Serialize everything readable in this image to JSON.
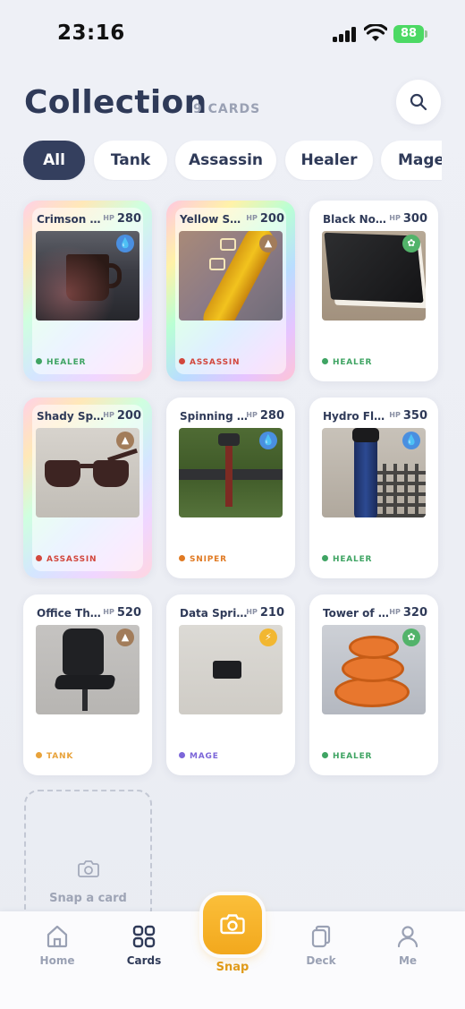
{
  "status_bar": {
    "time": "23:16",
    "battery": "88"
  },
  "header": {
    "title": "Collection",
    "count": "9 CARDS"
  },
  "filters": [
    "All",
    "Tank",
    "Assassin",
    "Healer",
    "Mage"
  ],
  "cards": [
    {
      "name": "Crimson Br...",
      "hp_label": "HP",
      "hp": "280",
      "role": "HEALER",
      "role_color": "#3fa463",
      "element_icon": "water-drop-icon",
      "element_color": "#4a8fe0",
      "photo": "mug"
    },
    {
      "name": "Yellow Spe...",
      "hp_label": "HP",
      "hp": "200",
      "role": "ASSASSIN",
      "role_color": "#d2473d",
      "element_icon": "mountain-icon",
      "element_color": "#a27c5a",
      "photo": "yellow-tube"
    },
    {
      "name": "Black Note...",
      "hp_label": "HP",
      "hp": "300",
      "role": "HEALER",
      "role_color": "#3fa463",
      "element_icon": "leaf-icon",
      "element_color": "#52b36a",
      "photo": "notebook"
    },
    {
      "name": "Shady Spec...",
      "hp_label": "HP",
      "hp": "200",
      "role": "ASSASSIN",
      "role_color": "#d2473d",
      "element_icon": "mountain-icon",
      "element_color": "#a27c5a",
      "photo": "sunglasses"
    },
    {
      "name": "Spinning Sp...",
      "hp_label": "HP",
      "hp": "280",
      "role": "SNIPER",
      "role_color": "#e07a23",
      "element_icon": "water-drop-icon",
      "element_color": "#4a8fe0",
      "photo": "sprinkler"
    },
    {
      "name": "Hydro Flask...",
      "hp_label": "HP",
      "hp": "350",
      "role": "HEALER",
      "role_color": "#3fa463",
      "element_icon": "water-drop-icon",
      "element_color": "#4a8fe0",
      "photo": "flask"
    },
    {
      "name": "Office Thro...",
      "hp_label": "HP",
      "hp": "520",
      "role": "TANK",
      "role_color": "#e8a23a",
      "element_icon": "mountain-icon",
      "element_color": "#a27c5a",
      "photo": "chair"
    },
    {
      "name": "Data Sprite",
      "hp_label": "HP",
      "hp": "210",
      "role": "MAGE",
      "role_color": "#7c66d9",
      "element_icon": "lightning-icon",
      "element_color": "#f2b731",
      "photo": "dongle"
    },
    {
      "name": "Tower of Tr...",
      "hp_label": "HP",
      "hp": "320",
      "role": "HEALER",
      "role_color": "#3fa463",
      "element_icon": "leaf-icon",
      "element_color": "#52b36a",
      "photo": "cat-toy"
    }
  ],
  "snap_tile": {
    "label": "Snap a card"
  },
  "tabbar": {
    "home": "Home",
    "cards": "Cards",
    "snap": "Snap",
    "deck": "Deck",
    "me": "Me"
  },
  "colors": {
    "accent": "#f2a81d",
    "primary": "#343f5e"
  }
}
